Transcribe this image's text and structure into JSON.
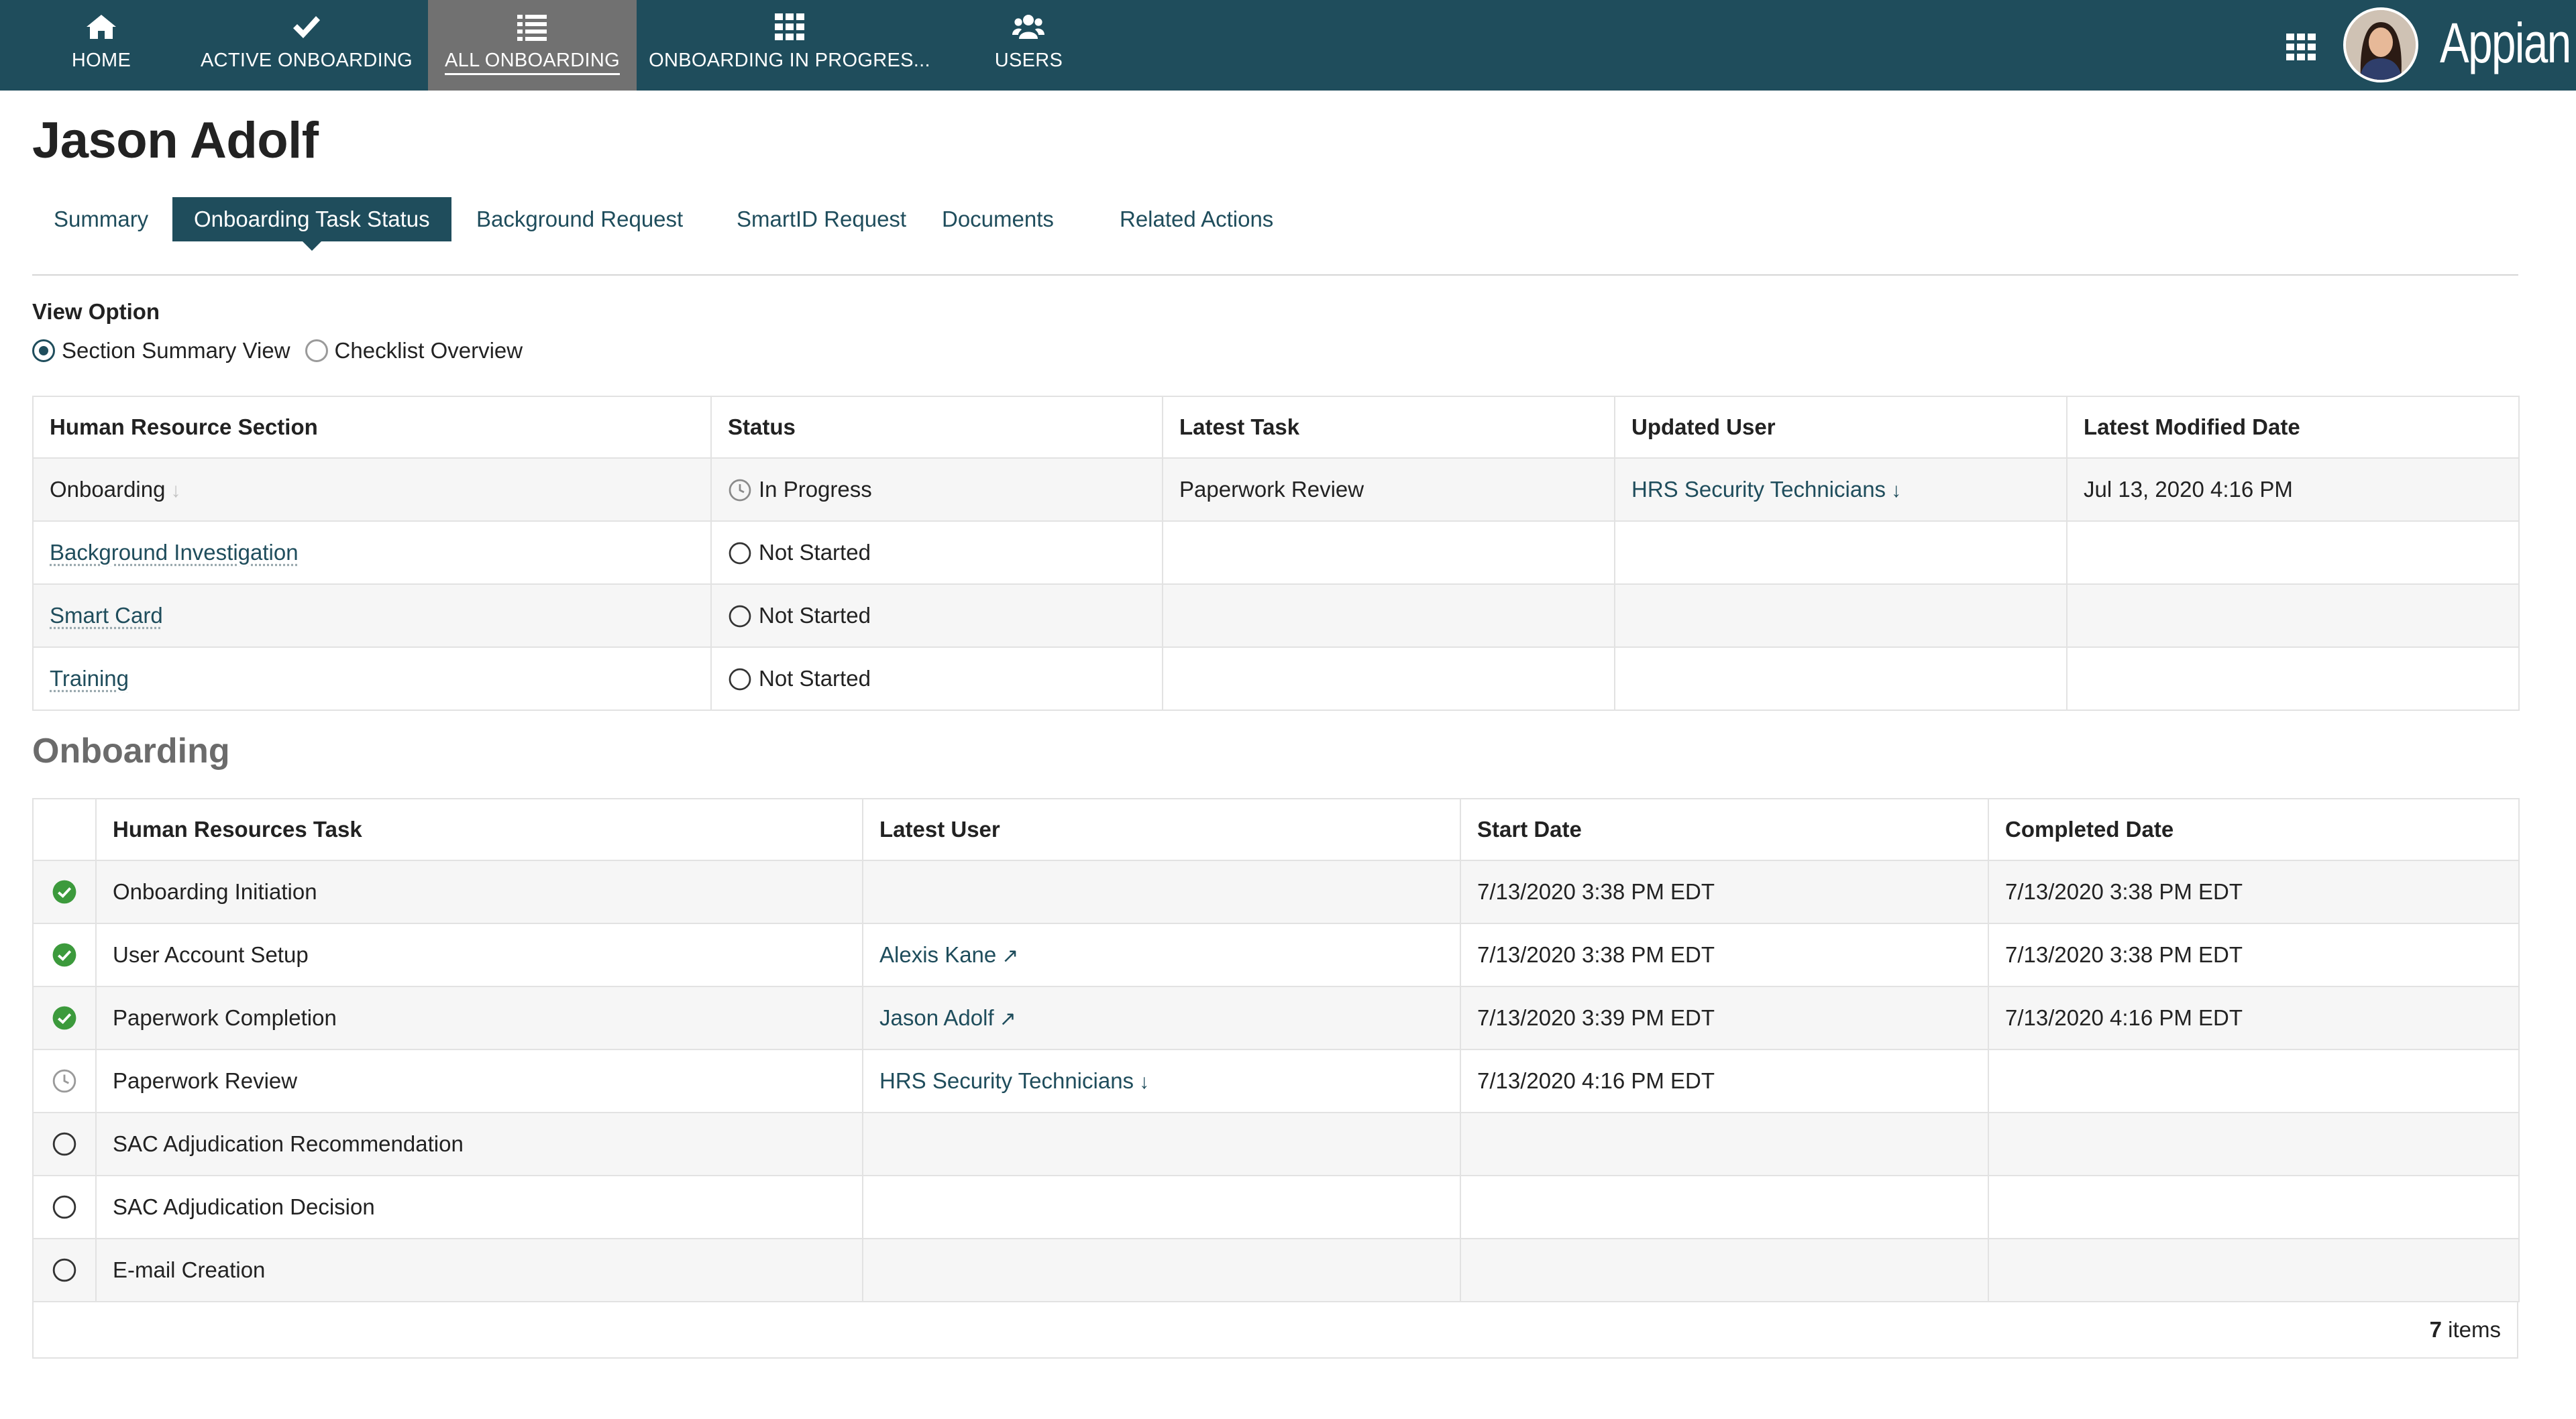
{
  "nav": {
    "items": [
      {
        "label": "HOME",
        "icon": "home-icon"
      },
      {
        "label": "ACTIVE ONBOARDING",
        "icon": "checkmark-icon"
      },
      {
        "label": "ALL ONBOARDING",
        "icon": "list-icon",
        "active": true
      },
      {
        "label": "ONBOARDING IN PROGRES...",
        "icon": "grid-icon"
      },
      {
        "label": "USERS",
        "icon": "users-icon"
      }
    ],
    "brand": "Appian",
    "accent_color": "#1f4d5c",
    "active_color": "#717171"
  },
  "page": {
    "title": "Jason Adolf"
  },
  "tabs": [
    {
      "label": "Summary"
    },
    {
      "label": "Onboarding Task Status",
      "active": true
    },
    {
      "label": "Background Request"
    },
    {
      "label": "SmartID Request"
    },
    {
      "label": "Documents"
    },
    {
      "label": "Related Actions"
    }
  ],
  "view_option": {
    "label": "View Option",
    "options": [
      {
        "label": "Section Summary View",
        "selected": true
      },
      {
        "label": "Checklist Overview",
        "selected": false
      }
    ]
  },
  "sections_table": {
    "headers": [
      "Human Resource Section",
      "Status",
      "Latest Task",
      "Updated User",
      "Latest Modified Date"
    ],
    "rows": [
      {
        "section": "Onboarding",
        "section_arrow": "↓",
        "status": "In Progress",
        "status_icon": "clock-icon",
        "latest_task": "Paperwork Review",
        "updated_user": "HRS Security Technicians",
        "updated_user_arrow": "↓",
        "modified": "Jul 13, 2020 4:16 PM"
      },
      {
        "section": "Background Investigation",
        "status": "Not Started",
        "status_icon": "circle-icon",
        "latest_task": "",
        "updated_user": "",
        "modified": ""
      },
      {
        "section": "Smart Card",
        "status": "Not Started",
        "status_icon": "circle-icon",
        "latest_task": "",
        "updated_user": "",
        "modified": ""
      },
      {
        "section": "Training",
        "status": "Not Started",
        "status_icon": "circle-icon",
        "latest_task": "",
        "updated_user": "",
        "modified": ""
      }
    ]
  },
  "onboarding": {
    "heading": "Onboarding",
    "headers": [
      "",
      "Human Resources Task",
      "Latest User",
      "Start Date",
      "Completed Date"
    ],
    "rows": [
      {
        "icon": "check-circle-icon",
        "task": "Onboarding Initiation",
        "user": "",
        "user_arrow": "",
        "start": "7/13/2020 3:38 PM EDT",
        "completed": "7/13/2020 3:38 PM EDT"
      },
      {
        "icon": "check-circle-icon",
        "task": "User Account Setup",
        "user": "Alexis Kane",
        "user_arrow": "↗",
        "start": "7/13/2020 3:38 PM EDT",
        "completed": "7/13/2020 3:38 PM EDT"
      },
      {
        "icon": "check-circle-icon",
        "task": "Paperwork Completion",
        "user": "Jason Adolf",
        "user_arrow": "↗",
        "start": "7/13/2020 3:39 PM EDT",
        "completed": "7/13/2020 4:16 PM EDT"
      },
      {
        "icon": "clock-icon",
        "task": "Paperwork Review",
        "user": "HRS Security Technicians",
        "user_arrow": "↓",
        "start": "7/13/2020 4:16 PM EDT",
        "completed": ""
      },
      {
        "icon": "circle-icon",
        "task": "SAC Adjudication Recommendation",
        "user": "",
        "user_arrow": "",
        "start": "",
        "completed": ""
      },
      {
        "icon": "circle-icon",
        "task": "SAC Adjudication Decision",
        "user": "",
        "user_arrow": "",
        "start": "",
        "completed": ""
      },
      {
        "icon": "circle-icon",
        "task": "E-mail Creation",
        "user": "",
        "user_arrow": "",
        "start": "",
        "completed": ""
      }
    ],
    "count": "7",
    "count_suffix": " items",
    "success_color": "#3c9a3c"
  }
}
